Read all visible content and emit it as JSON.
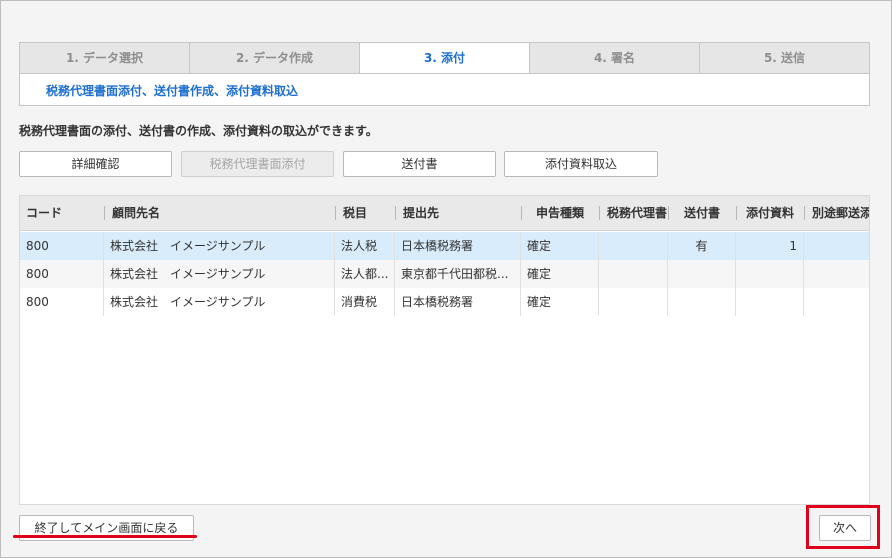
{
  "steps": [
    {
      "label": "1. データ選択",
      "active": false
    },
    {
      "label": "2. データ作成",
      "active": false
    },
    {
      "label": "3. 添付",
      "active": true
    },
    {
      "label": "4. 署名",
      "active": false
    },
    {
      "label": "5. 送信",
      "active": false
    }
  ],
  "step_subtitle": "税務代理書面添付、送付書作成、添付資料取込",
  "description": "税務代理書面の添付、送付書の作成、添付資料の取込ができます。",
  "actions": {
    "detail": "詳細確認",
    "attach_tax_doc": "税務代理書面添付",
    "cover_letter": "送付書",
    "import_attachments": "添付資料取込"
  },
  "table": {
    "columns": [
      "コード",
      "顧問先名",
      "税目",
      "提出先",
      "申告種類",
      "税務代理書",
      "送付書",
      "添付資料",
      "別途郵送添"
    ],
    "rows": [
      [
        "800",
        "株式会社　イメージサンプル",
        "法人税",
        "日本橋税務署",
        "確定",
        "",
        "有",
        "1",
        ""
      ],
      [
        "800",
        "株式会社　イメージサンプル",
        "法人都...",
        "東京都千代田都税...",
        "確定",
        "",
        "",
        "",
        ""
      ],
      [
        "800",
        "株式会社　イメージサンプル",
        "消費税",
        "日本橋税務署",
        "確定",
        "",
        "",
        "",
        ""
      ]
    ],
    "selected_row": 0
  },
  "footer": {
    "exit": "終了してメイン画面に戻る",
    "next": "次へ"
  },
  "colors": {
    "accent": "#1d6fd0",
    "highlight": "#e0001b",
    "selected_row": "#d9ecfb"
  }
}
